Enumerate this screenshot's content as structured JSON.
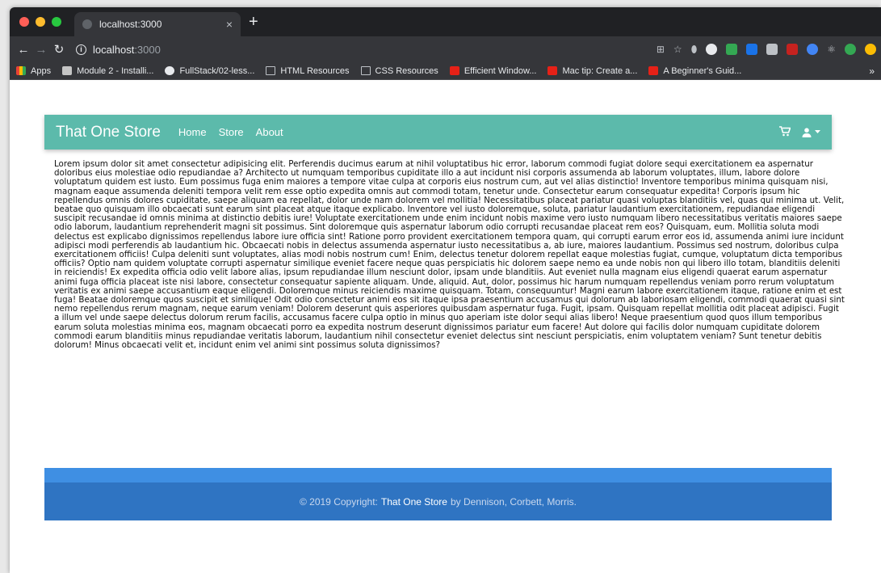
{
  "browser": {
    "tab_title": "localhost:3000",
    "tab_close": "×",
    "new_tab": "+",
    "url_host": "localhost",
    "url_port": ":3000",
    "bookmarks": [
      {
        "label": "Apps",
        "icon": "apps-icon"
      },
      {
        "label": "Module 2 - Installi...",
        "icon": "module-icon"
      },
      {
        "label": "FullStack/02-less...",
        "icon": "github-icon"
      },
      {
        "label": "HTML Resources",
        "icon": "folder-icon"
      },
      {
        "label": "CSS Resources",
        "icon": "folder-icon"
      },
      {
        "label": "Efficient Window...",
        "icon": "youtube-icon"
      },
      {
        "label": "Mac tip: Create a...",
        "icon": "youtube-icon"
      },
      {
        "label": "A Beginner's Guid...",
        "icon": "youtube-icon"
      }
    ],
    "bookmarks_more": "»"
  },
  "navbar": {
    "brand": "That One Store",
    "links": [
      "Home",
      "Store",
      "About"
    ],
    "cart_icon": "cart-icon",
    "user_icon": "user-icon"
  },
  "main": {
    "body_text": "Lorem ipsum dolor sit amet consectetur adipisicing elit. Perferendis ducimus earum at nihil voluptatibus hic error, laborum commodi fugiat dolore sequi exercitationem ea aspernatur doloribus eius molestiae odio repudiandae a? Architecto ut numquam temporibus cupiditate illo a aut incidunt nisi corporis assumenda ab laborum voluptates, illum, labore dolore voluptatum quidem est iusto. Eum possimus fuga enim maiores a tempore vitae culpa at corporis eius nostrum cum, aut vel alias distinctio! Inventore temporibus minima quisquam nisi, magnam eaque assumenda deleniti tempora velit rem esse optio expedita omnis aut commodi totam, tenetur unde. Consectetur earum consequatur expedita! Corporis ipsum hic repellendus omnis dolores cupiditate, saepe aliquam ea repellat, dolor unde nam dolorem vel mollitia! Necessitatibus placeat pariatur quasi voluptas blanditiis vel, quas qui minima ut. Velit, beatae quo quisquam illo obcaecati sunt earum sint placeat atque itaque explicabo. Inventore vel iusto doloremque, soluta, pariatur laudantium exercitationem, repudiandae eligendi suscipit recusandae id omnis minima at distinctio debitis iure! Voluptate exercitationem unde enim incidunt nobis maxime vero iusto numquam libero necessitatibus veritatis maiores saepe odio laborum, laudantium reprehenderit magni sit possimus. Sint doloremque quis aspernatur laborum odio corrupti recusandae placeat rem eos? Quisquam, eum. Mollitia soluta modi delectus est explicabo dignissimos repellendus labore iure officia sint! Ratione porro provident exercitationem tempora quam, qui corrupti earum error eos id, assumenda animi iure incidunt adipisci modi perferendis ab laudantium hic. Obcaecati nobis in delectus assumenda aspernatur iusto necessitatibus a, ab iure, maiores laudantium. Possimus sed nostrum, doloribus culpa exercitationem officiis! Culpa deleniti sunt voluptates, alias modi nobis nostrum cum! Enim, delectus tenetur dolorem repellat eaque molestias fugiat, cumque, voluptatum dicta temporibus officiis? Optio nam quidem voluptate corrupti aspernatur similique eveniet facere neque quas perspiciatis hic dolorem saepe nemo ea unde nobis non qui libero illo totam, blanditiis deleniti in reiciendis! Ex expedita officia odio velit labore alias, ipsum repudiandae illum nesciunt dolor, ipsam unde blanditiis. Aut eveniet nulla magnam eius eligendi quaerat earum aspernatur animi fuga officia placeat iste nisi labore, consectetur consequatur sapiente aliquam. Unde, aliquid. Aut, dolor, possimus hic harum numquam repellendus veniam porro rerum voluptatum veritatis ex animi saepe accusantium eaque eligendi. Doloremque minus reiciendis maxime quisquam. Totam, consequuntur! Magni earum labore exercitationem itaque, ratione enim et est fuga! Beatae doloremque quos suscipit et similique! Odit odio consectetur animi eos sit itaque ipsa praesentium accusamus qui dolorum ab laboriosam eligendi, commodi quaerat quasi sint nemo repellendus rerum magnam, neque earum veniam! Dolorem deserunt quis asperiores quibusdam aspernatur fuga. Fugit, ipsam. Quisquam repellat mollitia odit placeat adipisci. Fugit a illum vel unde saepe delectus dolorum rerum facilis, accusamus facere culpa optio in minus quo aperiam iste dolor sequi alias libero! Neque praesentium quod quos illum temporibus earum soluta molestias minima eos, magnam obcaecati porro ea expedita nostrum deserunt dignissimos pariatur eum facere! Aut dolore qui facilis dolor numquam cupiditate dolorem commodi earum blanditiis minus repudiandae veritatis laborum, laudantium nihil consectetur eveniet delectus sint nesciunt perspiciatis, enim voluptatem veniam? Sunt tenetur debitis dolorum! Minus obcaecati velit et, incidunt enim vel animi sint possimus soluta dignissimos?"
  },
  "footer": {
    "prefix": "© 2019 Copyright:",
    "store": "That One Store",
    "suffix": "by Dennison, Corbett, Morris."
  },
  "colors": {
    "navbar": "#5cbaab",
    "footer_top": "#3f8fe3",
    "footer": "#2f74c2"
  }
}
